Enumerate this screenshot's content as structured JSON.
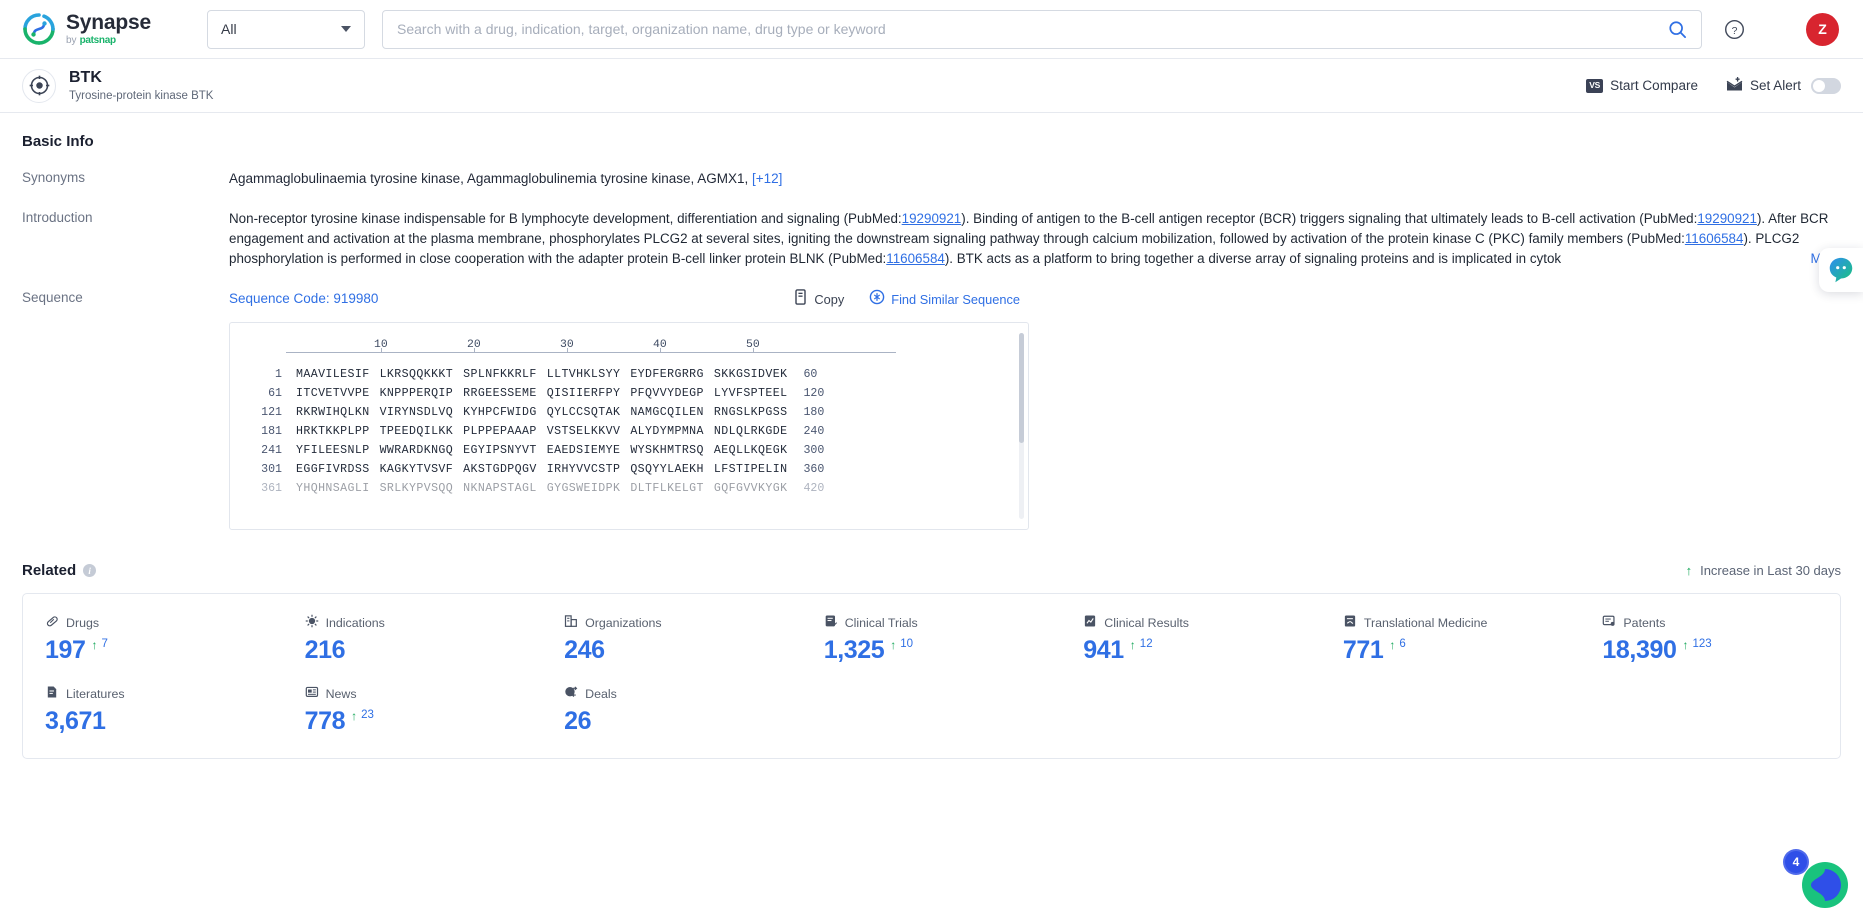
{
  "header": {
    "brand_name": "Synapse",
    "brand_by": "by",
    "brand_company": "patsnap",
    "scope_select": "All",
    "search_placeholder": "Search with a drug, indication, target, organization name, drug type or keyword",
    "search_value": "",
    "avatar_initial": "Z"
  },
  "entity": {
    "title": "BTK",
    "subtitle": "Tyrosine-protein kinase BTK",
    "compare_label": "Start Compare",
    "compare_badge": "VS",
    "alert_label": "Set Alert"
  },
  "basic_info": {
    "heading": "Basic Info",
    "synonyms_label": "Synonyms",
    "synonyms_value": "Agammaglobulinaemia tyrosine kinase,  Agammaglobulinemia tyrosine kinase,  AGMX1,",
    "synonyms_more": "[+12]",
    "introduction_label": "Introduction",
    "introduction_part1": "Non-receptor tyrosine kinase indispensable for B lymphocyte development, differentiation and signaling (PubMed:",
    "pubmed_1": "19290921",
    "introduction_part2": "). Binding of antigen to the B-cell antigen receptor (BCR) triggers signaling that ultimately leads to B-cell activation (PubMed:",
    "pubmed_2": "19290921",
    "introduction_part3": "). After BCR engagement and activation at the plasma membrane, phosphorylates PLCG2 at several sites, igniting the downstream signaling pathway through calcium mobilization, followed by activation of the protein kinase C (PKC) family members (PubMed:",
    "pubmed_3": "11606584",
    "introduction_part4": "). PLCG2 phosphorylation is performed in close cooperation with the adapter protein B-cell linker protein BLNK (PubMed:",
    "pubmed_4": "11606584",
    "introduction_part5": "). BTK acts as a platform to bring together a diverse array of signaling proteins and is implicated in cytok",
    "more_label": "More"
  },
  "sequence": {
    "label": "Sequence",
    "code_label": "Sequence Code: 919980",
    "copy_label": "Copy",
    "similar_label": "Find Similar Sequence",
    "ruler_ticks": [
      "10",
      "20",
      "30",
      "40",
      "50"
    ],
    "rows": [
      {
        "start": "1",
        "end": "60",
        "chunks": [
          "MAAVILESIF",
          "LKRSQQKKKT",
          "SPLNFKKRLF",
          "LLTVHKLSYY",
          "EYDFERGRRG",
          "SKKGSIDVEK"
        ]
      },
      {
        "start": "61",
        "end": "120",
        "chunks": [
          "ITCVETVVPE",
          "KNPPPERQIP",
          "RRGEESSEME",
          "QISIIERFPY",
          "PFQVVYDEGP",
          "LYVFSPTEEL"
        ]
      },
      {
        "start": "121",
        "end": "180",
        "chunks": [
          "RKRWIHQLKN",
          "VIRYNSDLVQ",
          "KYHPCFWIDG",
          "QYLCCSQTAK",
          "NAMGCQILEN",
          "RNGSLKPGSS"
        ]
      },
      {
        "start": "181",
        "end": "240",
        "chunks": [
          "HRKTKKPLPP",
          "TPEEDQILKK",
          "PLPPEPAAAP",
          "VSTSELKKVV",
          "ALYDYMPMNA",
          "NDLQLRKGDE"
        ]
      },
      {
        "start": "241",
        "end": "300",
        "chunks": [
          "YFILEESNLP",
          "WWRARDKNGQ",
          "EGYIPSNYVT",
          "EAEDSIEMYE",
          "WYSKHMTRSQ",
          "AEQLLKQEGK"
        ]
      },
      {
        "start": "301",
        "end": "360",
        "chunks": [
          "EGGFIVRDSS",
          "KAGKYTVSVF",
          "AKSTGDPQGV",
          "IRHYVVCSTP",
          "QSQYYLAEKH",
          "LFSTIPELIN"
        ]
      },
      {
        "start": "361",
        "end": "420",
        "chunks": [
          "YHQHNSAGLI",
          "SRLKYPVSQQ",
          "NKNAPSTAGL",
          "GYGSWEIDPK",
          "DLTFLKELGT",
          "GQFGVVKYGK"
        ]
      }
    ]
  },
  "related": {
    "heading": "Related",
    "increase_note": "Increase in Last 30 days",
    "stats": [
      {
        "icon": "pill-icon",
        "label": "Drugs",
        "value": "197",
        "delta": "7"
      },
      {
        "icon": "virus-icon",
        "label": "Indications",
        "value": "216",
        "delta": ""
      },
      {
        "icon": "building-icon",
        "label": "Organizations",
        "value": "246",
        "delta": ""
      },
      {
        "icon": "clinical-trial-icon",
        "label": "Clinical Trials",
        "value": "1,325",
        "delta": "10"
      },
      {
        "icon": "clinical-result-icon",
        "label": "Clinical Results",
        "value": "941",
        "delta": "12"
      },
      {
        "icon": "translational-icon",
        "label": "Translational Medicine",
        "value": "771",
        "delta": "6"
      },
      {
        "icon": "patent-icon",
        "label": "Patents",
        "value": "18,390",
        "delta": "123"
      },
      {
        "icon": "literature-icon",
        "label": "Literatures",
        "value": "3,671",
        "delta": ""
      },
      {
        "icon": "news-icon",
        "label": "News",
        "value": "778",
        "delta": "23"
      },
      {
        "icon": "deal-icon",
        "label": "Deals",
        "value": "26",
        "delta": ""
      }
    ]
  },
  "widgets": {
    "fab_badge": "4"
  },
  "colors": {
    "accent_blue": "#2f6fe4",
    "increase_green": "#1aa85c",
    "avatar_red": "#d8252f",
    "fab_green": "#19c37d",
    "fab_blue": "#2f4fe8"
  }
}
